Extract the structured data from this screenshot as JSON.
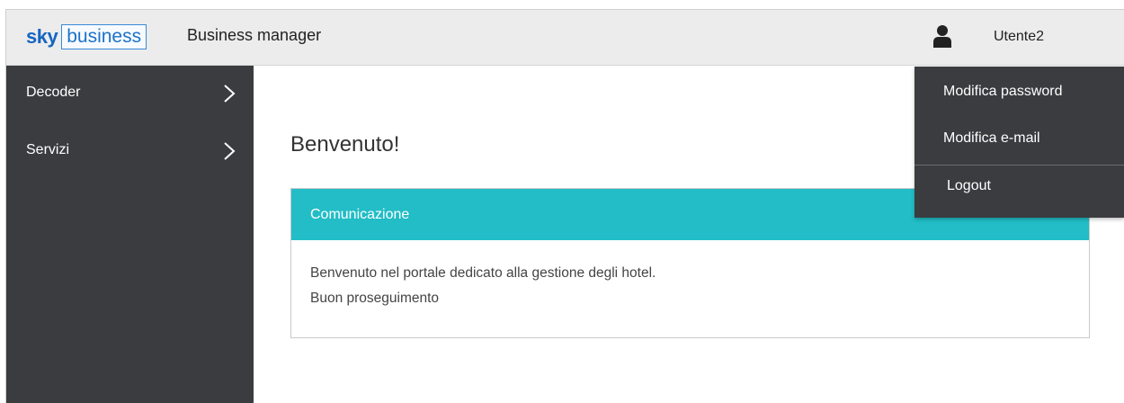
{
  "header": {
    "logo_sky": "sky",
    "logo_business": "business",
    "app_title": "Business manager",
    "user_name": "Utente2",
    "user_icon": "user-icon"
  },
  "sidebar": {
    "items": [
      {
        "label": "Decoder",
        "icon": "chevron-right-icon"
      },
      {
        "label": "Servizi",
        "icon": "chevron-right-icon"
      }
    ]
  },
  "main": {
    "welcome": "Benvenuto!",
    "panel": {
      "title": "Comunicazione",
      "lines": [
        "Benvenuto nel portale dedicato alla gestione degli hotel.",
        "Buon proseguimento"
      ]
    }
  },
  "user_menu": {
    "items": [
      "Modifica password",
      "Modifica e-mail",
      "Logout"
    ]
  },
  "colors": {
    "brand_blue": "#1e73c8",
    "panel_header": "#22bdc6",
    "sidebar_bg": "#3a3c3f",
    "topbar_bg": "#ececed"
  }
}
